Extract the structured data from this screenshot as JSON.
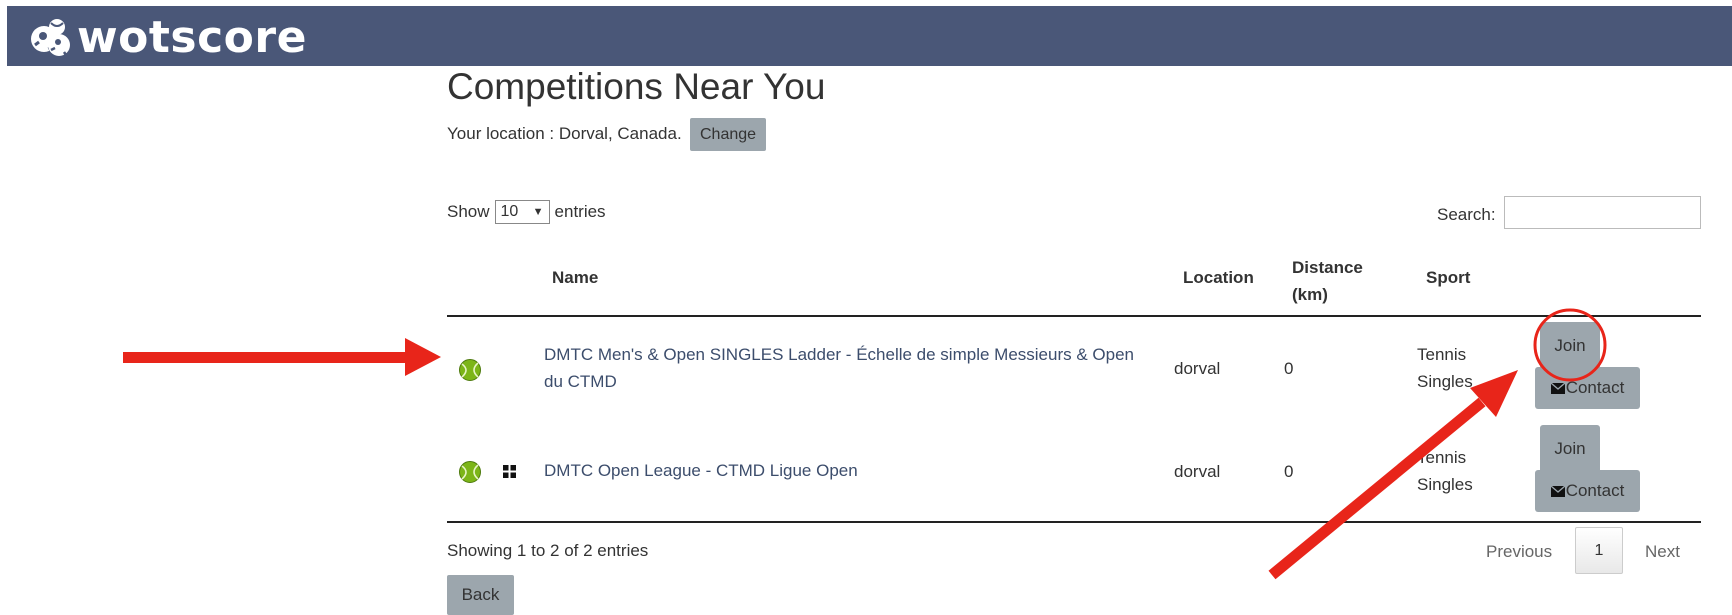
{
  "brand": {
    "name": "wotscore"
  },
  "page": {
    "title": "Competitions Near You",
    "location_text": "Your location : Dorval, Canada.",
    "change_label": "Change"
  },
  "table_controls": {
    "show_label": "Show",
    "page_length": "10",
    "entries_label": "entries",
    "search_label": "Search:",
    "search_value": ""
  },
  "table": {
    "headers": {
      "name": "Name",
      "location": "Location",
      "distance_line1": "Distance",
      "distance_line2": "(km)",
      "sport": "Sport"
    },
    "rows": [
      {
        "name_line1": "DMTC Men's & Open SINGLES Ladder - Échelle de simple Messieurs & Open",
        "name_line2": "du CTMD",
        "location": "dorval",
        "distance": "0",
        "sport_line1": "Tennis",
        "sport_line2": "Singles",
        "join_label": "Join",
        "contact_label": "Contact",
        "icons": [
          "tennis-ball-icon"
        ]
      },
      {
        "name_line1": "DMTC Open League - CTMD Ligue Open",
        "location": "dorval",
        "distance": "0",
        "sport_line1": "Tennis",
        "sport_line2": "Singles",
        "join_label": "Join",
        "contact_label": "Contact",
        "icons": [
          "tennis-ball-icon",
          "grid-icon"
        ]
      }
    ]
  },
  "footer": {
    "info": "Showing 1 to 2 of 2 entries",
    "previous_label": "Previous",
    "current_page": "1",
    "next_label": "Next",
    "back_label": "Back"
  },
  "colors": {
    "header_bg": "#4a5778",
    "button_bg": "#9ca6ad",
    "link": "#3c4d6c",
    "annotation": "#e8251a"
  }
}
